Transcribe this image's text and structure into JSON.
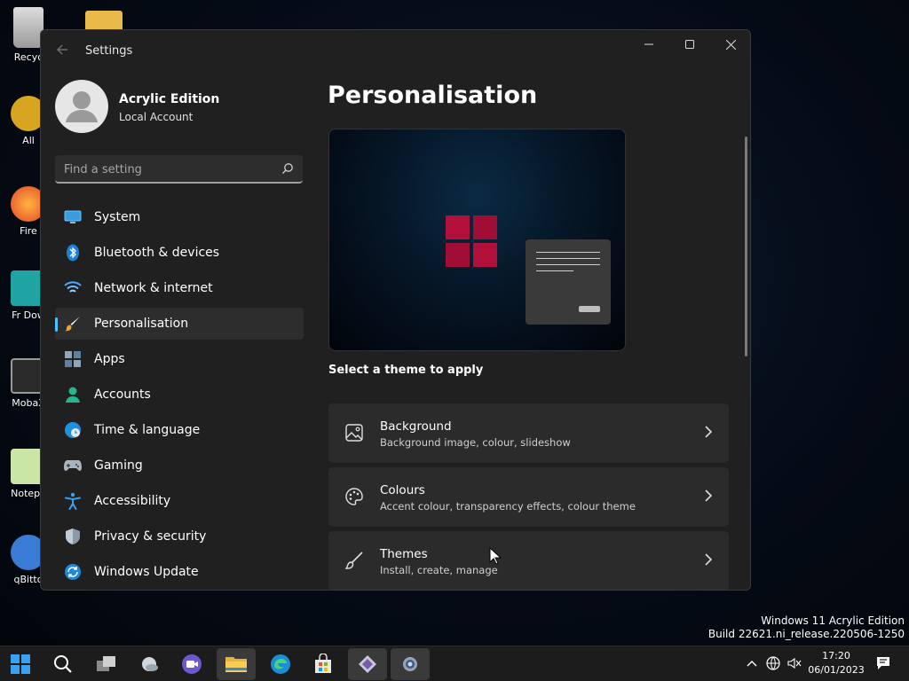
{
  "desktop": {
    "icons": [
      {
        "label": "Recyc"
      },
      {
        "label": "All"
      },
      {
        "label": "Fire"
      },
      {
        "label": "Fr Dow"
      },
      {
        "label": "MobaX"
      },
      {
        "label": "Notepa"
      },
      {
        "label": "qBitto"
      }
    ]
  },
  "window": {
    "title": "Settings"
  },
  "account": {
    "name": "Acrylic Edition",
    "type": "Local Account"
  },
  "search": {
    "placeholder": "Find a setting"
  },
  "nav": {
    "items": [
      {
        "label": "System",
        "icon": "monitor-icon"
      },
      {
        "label": "Bluetooth & devices",
        "icon": "bluetooth-icon"
      },
      {
        "label": "Network & internet",
        "icon": "wifi-icon"
      },
      {
        "label": "Personalisation",
        "icon": "paintbrush-icon",
        "active": true
      },
      {
        "label": "Apps",
        "icon": "apps-icon"
      },
      {
        "label": "Accounts",
        "icon": "person-icon"
      },
      {
        "label": "Time & language",
        "icon": "globe-clock-icon"
      },
      {
        "label": "Gaming",
        "icon": "gamepad-icon"
      },
      {
        "label": "Accessibility",
        "icon": "accessibility-icon"
      },
      {
        "label": "Privacy & security",
        "icon": "shield-icon"
      },
      {
        "label": "Windows Update",
        "icon": "update-icon"
      }
    ]
  },
  "main": {
    "title": "Personalisation",
    "theme_prompt": "Select a theme to apply",
    "cards": [
      {
        "title": "Background",
        "subtitle": "Background image, colour, slideshow",
        "icon": "image-icon"
      },
      {
        "title": "Colours",
        "subtitle": "Accent colour, transparency effects, colour theme",
        "icon": "palette-icon"
      },
      {
        "title": "Themes",
        "subtitle": "Install, create, manage",
        "icon": "brush-icon"
      }
    ]
  },
  "watermark": {
    "line1": "Windows 11 Acrylic Edition",
    "line2": "Build 22621.ni_release.220506-1250"
  },
  "clock": {
    "time": "17:20",
    "date": "06/01/2023"
  },
  "colors": {
    "accent": "#4cc2ff",
    "window_bg": "#202020",
    "card_bg": "#2b2b2b",
    "logo": "#b0103a"
  }
}
